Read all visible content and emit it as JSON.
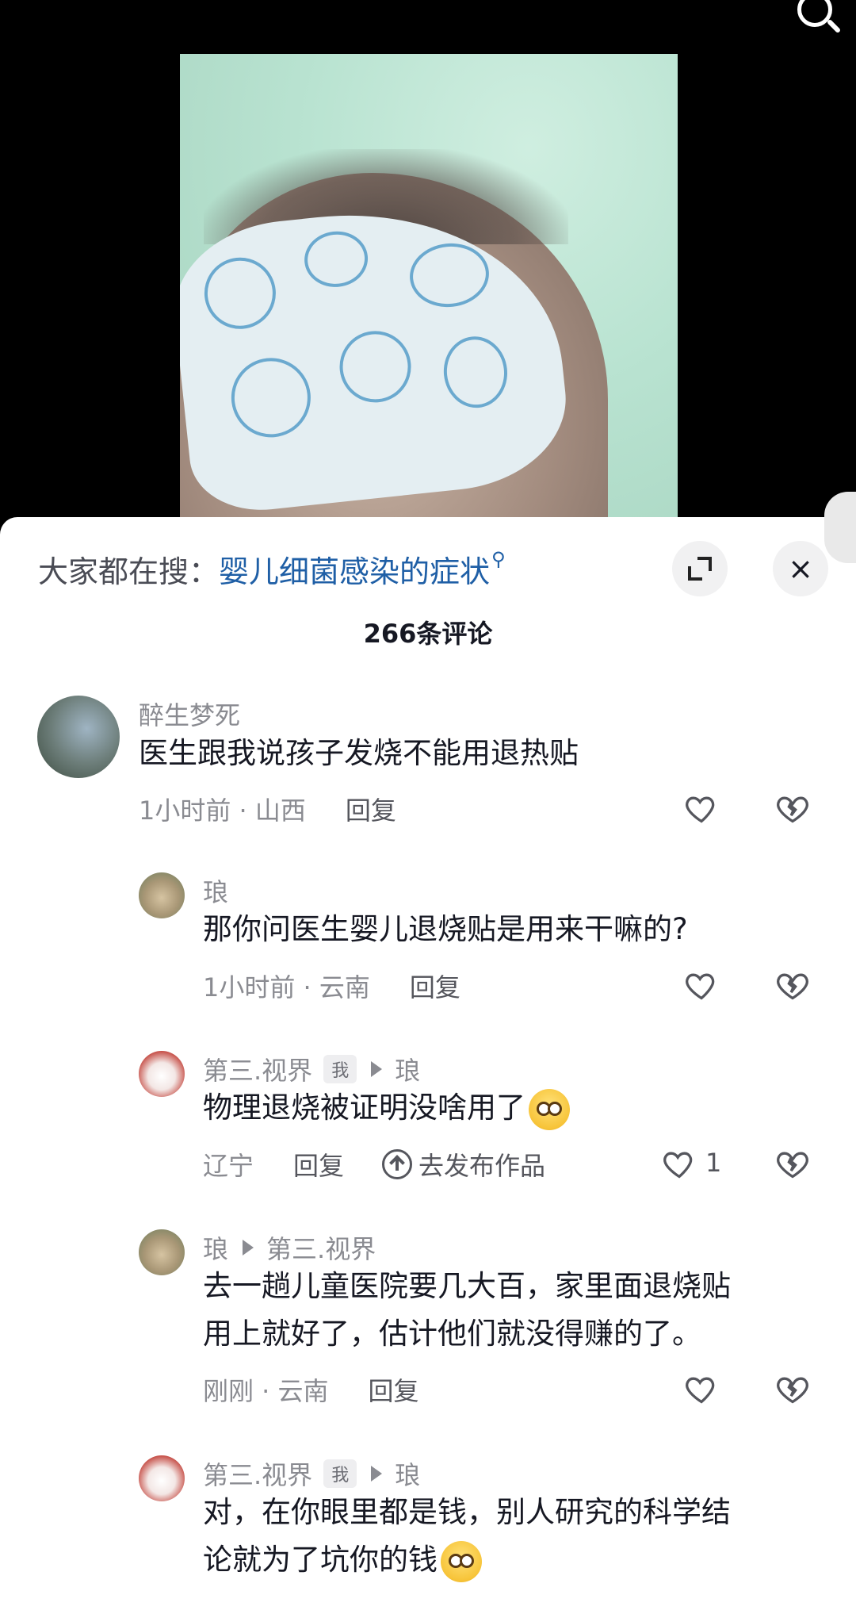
{
  "search": {
    "prefix": "大家都在搜：",
    "term": "婴儿细菌感染的症状",
    "term_icon": "search-icon"
  },
  "comments_count": "266条评论",
  "close_glyph": "×",
  "comments": [
    {
      "user": "醉生梦死",
      "text": "医生跟我说孩子发烧不能用退热贴",
      "time": "1小时前 · 山西",
      "reply": "回复"
    },
    {
      "user": "琅",
      "text": "那你问医生婴儿退烧贴是用来干嘛的?",
      "time": "1小时前 · 云南",
      "reply": "回复"
    },
    {
      "user": "第三.视界",
      "badge": "我",
      "reply_to": "琅",
      "text": "物理退烧被证明没啥用了",
      "time": "辽宁",
      "reply": "回复",
      "publish": "去发布作品",
      "likes": "1"
    },
    {
      "user": "琅",
      "reply_to": "第三.视界",
      "text_line1": "去一趟儿童医院要几大百，家里面退烧贴",
      "text_line2": "用上就好了，估计他们就没得赚的了。",
      "time": "刚刚 · 云南",
      "reply": "回复"
    },
    {
      "user": "第三.视界",
      "badge": "我",
      "reply_to": "琅",
      "text_line1": "对，在你眼里都是钱，别人研究的科学结",
      "text_line2": "论就为了坑你的钱"
    }
  ]
}
